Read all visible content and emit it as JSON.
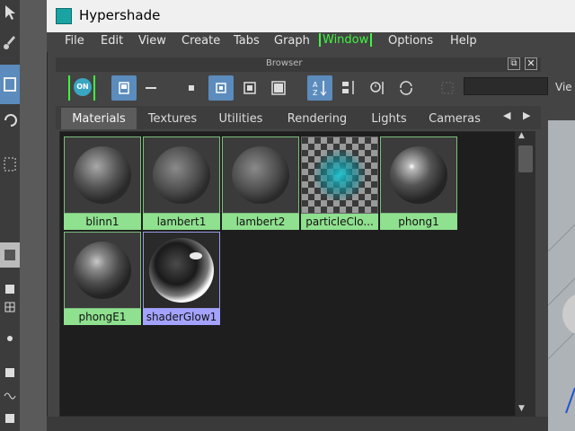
{
  "window": {
    "title": "Hypershade"
  },
  "menu": [
    "File",
    "Edit",
    "View",
    "Create",
    "Tabs",
    "Graph",
    "Window",
    "Options",
    "Help"
  ],
  "browser": {
    "title": "Browser",
    "float_icon": "⧉",
    "close_icon": "✕",
    "on_label": "ON"
  },
  "tabs": [
    "Materials",
    "Textures",
    "Utilities",
    "Rendering",
    "Lights",
    "Cameras"
  ],
  "active_tab": "Materials",
  "tab_nav": {
    "prev": "◀",
    "next": "▶"
  },
  "swatches": [
    {
      "label": "blinn1",
      "type": "blinn"
    },
    {
      "label": "lambert1",
      "type": "lambert"
    },
    {
      "label": "lambert2",
      "type": "lambert"
    },
    {
      "label": "particleClo...",
      "type": "particle-cloud"
    },
    {
      "label": "phong1",
      "type": "phong"
    },
    {
      "label": "phongE1",
      "type": "phongE"
    },
    {
      "label": "shaderGlow1",
      "type": "glow",
      "selected": true
    }
  ],
  "right_view": {
    "label": "Vie"
  },
  "scroll": {
    "up": "▲",
    "down": "▼"
  },
  "colors": {
    "accent_green": "#3ef53e",
    "swatch_label_green": "#8fe08f",
    "selected_label": "#a3a3ff",
    "active_tool": "#5b8cbd"
  }
}
